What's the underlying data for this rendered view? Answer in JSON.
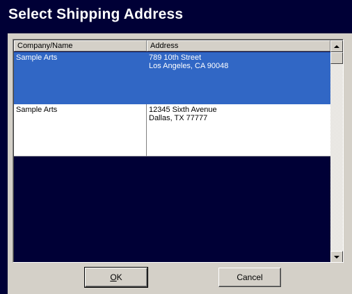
{
  "dialog": {
    "title": "Select Shipping Address"
  },
  "table": {
    "columns": [
      "Company/Name",
      "Address"
    ],
    "rows": [
      {
        "company": "Sample Arts",
        "address_line1": "789 10th Street",
        "address_line2": "Los Angeles, CA 90048",
        "selected": true
      },
      {
        "company": "Sample Arts",
        "address_line1": "12345 Sixth Avenue",
        "address_line2": "Dallas, TX 77777",
        "selected": false
      }
    ]
  },
  "buttons": {
    "ok_mnemonic": "O",
    "ok_rest": "K",
    "cancel": "Cancel"
  },
  "colors": {
    "background": "#000036",
    "selection": "#3167c5",
    "face": "#d4d0c8"
  },
  "icons": [
    "scroll-up-icon",
    "scroll-down-icon"
  ]
}
